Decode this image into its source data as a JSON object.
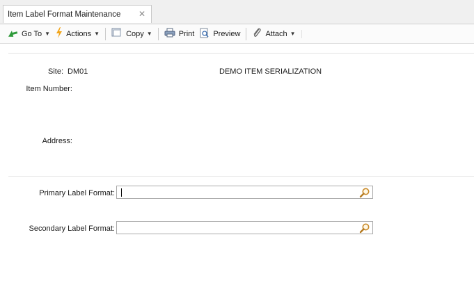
{
  "tab": {
    "title": "Item Label Format Maintenance",
    "close_glyph": "✕"
  },
  "toolbar": [
    {
      "name": "goto-button",
      "label": "Go To",
      "icon": "green-arrow-icon",
      "has_menu": true
    },
    {
      "name": "actions-button",
      "label": "Actions",
      "icon": "lightning-icon",
      "has_menu": true
    },
    {
      "name": "copy-button",
      "label": "Copy",
      "icon": "copy-icon",
      "has_menu": true
    },
    {
      "name": "print-button",
      "label": "Print",
      "icon": "printer-icon",
      "has_menu": false
    },
    {
      "name": "preview-button",
      "label": "Preview",
      "icon": "preview-icon",
      "has_menu": false
    },
    {
      "name": "attach-button",
      "label": "Attach",
      "icon": "paperclip-icon",
      "has_menu": true
    }
  ],
  "header": {
    "site_label": "Site:",
    "site_value": "DM01",
    "site_description": "DEMO ITEM SERIALIZATION",
    "item_number_label": "Item Number:",
    "address_label": "Address:"
  },
  "fields": {
    "primary_label": "Primary Label Format:",
    "primary_value": "",
    "secondary_label": "Secondary Label Format:",
    "secondary_value": ""
  },
  "colors": {
    "accent_green": "#2e9a3a",
    "lightning": "#f2a51a",
    "lookup_icon": "#c98a2a"
  }
}
